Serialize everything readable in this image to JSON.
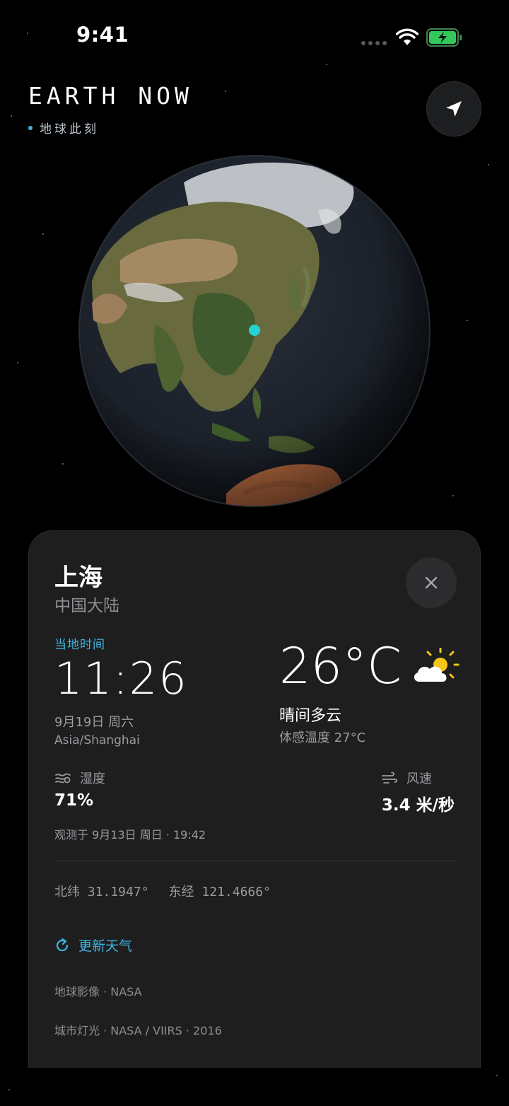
{
  "status_bar": {
    "time": "9:41"
  },
  "header": {
    "title": "EARTH NOW",
    "subtitle": "地球此刻"
  },
  "colors": {
    "accent": "#3fb7e0",
    "marker": "#25d0d6",
    "card_bg": "#1e1e1f"
  },
  "icons": [
    "wifi-icon",
    "battery-charging-icon",
    "location-arrow-icon",
    "close-icon",
    "partly-sunny-icon",
    "humidity-icon",
    "wind-icon",
    "refresh-icon"
  ],
  "card": {
    "city": "上海",
    "region": "中国大陆",
    "local_time_label": "当地时间",
    "local_time": "11:26",
    "local_date": "9月19日 周六",
    "timezone": "Asia/Shanghai",
    "temperature": "26°C",
    "condition": "晴间多云",
    "feels_like": "体感温度 27°C",
    "humidity_label": "湿度",
    "humidity_value": "71%",
    "wind_label": "风速",
    "wind_value": "3.4 米/秒",
    "observed": "观测于 9月13日 周日 · 19:42",
    "latitude": "北纬 31.1947°",
    "longitude": "东经 121.4666°",
    "refresh_label": "更新天气",
    "credit_imagery": "地球影像 · NASA",
    "credit_lights": "城市灯光 · NASA / VIIRS · 2016"
  }
}
